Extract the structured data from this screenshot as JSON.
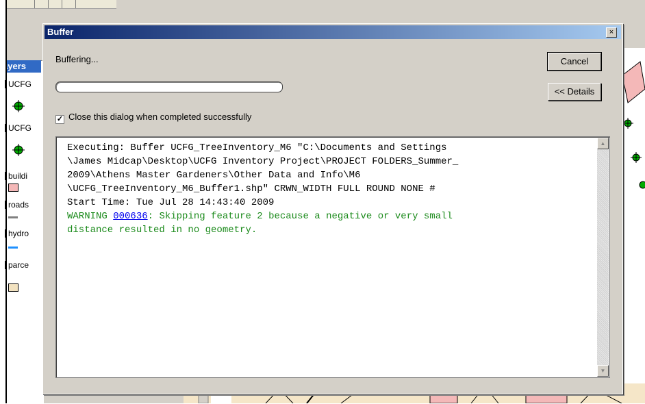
{
  "toc": {
    "header": "ayers",
    "layers": [
      "UCFG",
      "UCFG",
      "buildi",
      "roads",
      "hydro",
      "parce"
    ]
  },
  "dialog": {
    "title": "Buffer",
    "close_glyph": "×",
    "status_text": "Buffering...",
    "progress": 0,
    "cancel_label": "Cancel",
    "details_label": "<< Details",
    "close_when_done_label": "Close this dialog when completed successfully",
    "close_when_done_checked": true,
    "log": {
      "lines": [
        "Executing: Buffer UCFG_TreeInventory_M6 \"C:\\Documents and Settings",
        "\\James Midcap\\Desktop\\UCFG Inventory Project\\PROJECT FOLDERS_Summer_",
        "2009\\Athens Master Gardeners\\Other Data and Info\\M6",
        "\\UCFG_TreeInventory_M6_Buffer1.shp\" CRWN_WIDTH FULL ROUND NONE #",
        "Start Time: Tue Jul 28 14:43:40 2009"
      ],
      "warning_prefix": "WARNING ",
      "warning_code": "000636",
      "warning_rest_line1": ": Skipping feature 2 because a negative or very small",
      "warning_line2": "distance resulted in no geometry."
    }
  },
  "colors": {
    "titlebar": "#0a246a",
    "warning_text": "#1a8a1a",
    "link": "#0000ee",
    "point_symbol": "#00aa00",
    "buildings_fill": "#f4b8b8",
    "roads_line": "#808080",
    "hydro_line": "#1e90ff",
    "parcels_fill": "#f2e2c0"
  }
}
